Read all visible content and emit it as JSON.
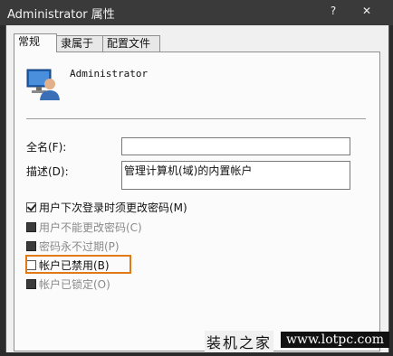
{
  "window": {
    "title": "Administrator 属性",
    "help_glyph": "?",
    "close_glyph": "✕"
  },
  "tabs": [
    {
      "label": "常规",
      "active": true
    },
    {
      "label": "隶属于",
      "active": false
    },
    {
      "label": "配置文件",
      "active": false
    }
  ],
  "general": {
    "username": "Administrator",
    "full_name_label": "全名(F):",
    "full_name_value": "",
    "description_label": "描述(D):",
    "description_value": "管理计算机(域)的内置帐户"
  },
  "options": [
    {
      "label": "用户下次登录时须更改密码(M)",
      "checked": true,
      "enabled": true
    },
    {
      "label": "用户不能更改密码(C)",
      "checked": false,
      "enabled": false
    },
    {
      "label": "密码永不过期(P)",
      "checked": false,
      "enabled": false
    },
    {
      "label": "帐户已禁用(B)",
      "checked": false,
      "enabled": true,
      "highlighted": true
    },
    {
      "label": "帐户已锁定(O)",
      "checked": false,
      "enabled": false
    }
  ],
  "watermark": {
    "cn": "装机之家",
    "url": "www.lotpc.com"
  },
  "colors": {
    "highlight_border": "#e07a14",
    "titlebar": "#3a3a3a"
  }
}
